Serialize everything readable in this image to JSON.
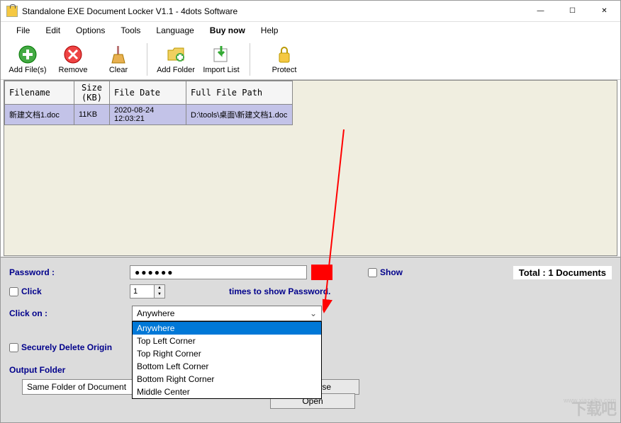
{
  "titlebar": {
    "title": "Standalone EXE Document Locker V1.1 - 4dots Software"
  },
  "menu": {
    "items": [
      "File",
      "Edit",
      "Options",
      "Tools",
      "Language",
      "Buy now",
      "Help"
    ]
  },
  "toolbar": {
    "add_files": "Add File(s)",
    "remove": "Remove",
    "clear": "Clear",
    "add_folder": "Add Folder",
    "import_list": "Import List",
    "protect": "Protect"
  },
  "grid": {
    "headers": {
      "filename": "Filename",
      "size": "Size\n(KB)",
      "filedate": "File Date",
      "fullpath": "Full File Path"
    },
    "rows": [
      {
        "filename": "新建文档1.doc",
        "size": "11KB",
        "filedate": "2020-08-24 12:03:21",
        "fullpath": "D:\\tools\\桌面\\新建文档1.doc"
      }
    ]
  },
  "form": {
    "password_label": "Password :",
    "password_value": "●●●●●●",
    "show_label": "Show",
    "total_label": "Total : 1 Documents",
    "click_label": "Click",
    "spin_value": "1",
    "times_label": "times to show Password.",
    "clickon_label": "Click on :",
    "combo_selected": "Anywhere",
    "combo_options": [
      "Anywhere",
      "Top Left Corner",
      "Top Right Corner",
      "Bottom Left Corner",
      "Bottom Right Corner",
      "Middle Center"
    ],
    "secdel_label": "Securely Delete Origin",
    "output_label": "Output Folder",
    "output_value": "Same Folder of Document",
    "browse_label": "Browse",
    "open_label": "Open"
  },
  "watermark": {
    "small": "www.xiazaiba.com",
    "big": "下载吧"
  }
}
